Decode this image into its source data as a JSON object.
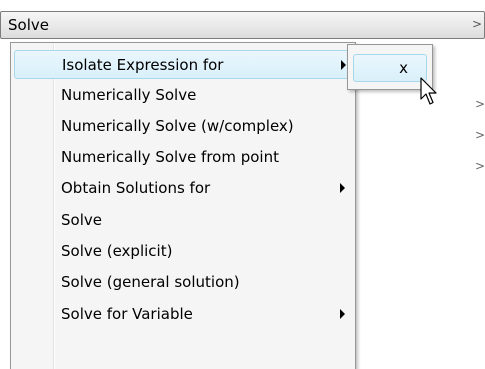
{
  "top_menu": {
    "label": "Solve",
    "arrow": ">"
  },
  "background_arrows": [
    ">",
    ">",
    ">"
  ],
  "submenu": {
    "items": [
      {
        "label": "Isolate Expression for",
        "has_submenu": true,
        "highlighted": true
      },
      {
        "label": "Numerically Solve",
        "has_submenu": false,
        "highlighted": false
      },
      {
        "label": "Numerically Solve (w/complex)",
        "has_submenu": false,
        "highlighted": false
      },
      {
        "label": "Numerically Solve from point",
        "has_submenu": false,
        "highlighted": false
      },
      {
        "label": "Obtain Solutions for",
        "has_submenu": true,
        "highlighted": false
      },
      {
        "label": "Solve",
        "has_submenu": false,
        "highlighted": false
      },
      {
        "label": "Solve (explicit)",
        "has_submenu": false,
        "highlighted": false
      },
      {
        "label": "Solve (general solution)",
        "has_submenu": false,
        "highlighted": false
      },
      {
        "label": "Solve for Variable",
        "has_submenu": true,
        "highlighted": false
      }
    ]
  },
  "nested_submenu": {
    "items": [
      {
        "label": "x",
        "highlighted": true
      }
    ]
  },
  "colors": {
    "highlight_fill": "#d9f0fa",
    "highlight_border": "#a8d8eb",
    "menu_background": "#f5f5f5"
  },
  "cursor": "arrow-cursor-icon"
}
